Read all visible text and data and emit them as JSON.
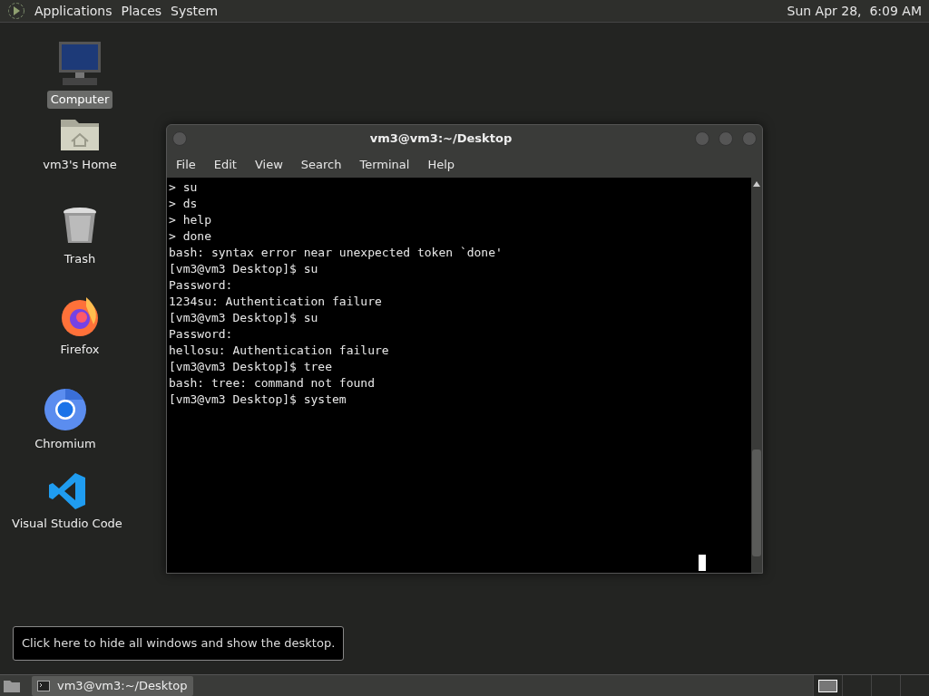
{
  "top_panel": {
    "menus": [
      "Applications",
      "Places",
      "System"
    ],
    "clock": "Sun Apr 28,  6:09 AM"
  },
  "desktop_icons": [
    {
      "kind": "computer",
      "label": "Computer",
      "selected": true
    },
    {
      "kind": "home",
      "label": "vm3's Home",
      "selected": false
    },
    {
      "kind": "trash",
      "label": "Trash",
      "selected": false
    },
    {
      "kind": "firefox",
      "label": "Firefox",
      "selected": false
    },
    {
      "kind": "chromium",
      "label": "Chromium",
      "selected": false
    },
    {
      "kind": "vscode",
      "label": "Visual Studio Code",
      "selected": false
    }
  ],
  "terminal": {
    "title": "vm3@vm3:~/Desktop",
    "menus": [
      "File",
      "Edit",
      "View",
      "Search",
      "Terminal",
      "Help"
    ],
    "lines": [
      "> su",
      "> ds",
      "> help",
      "> done",
      "bash: syntax error near unexpected token `done'",
      "[vm3@vm3 Desktop]$ su",
      "Password:",
      "1234su: Authentication failure",
      "[vm3@vm3 Desktop]$ su",
      "Password:",
      "hellosu: Authentication failure",
      "[vm3@vm3 Desktop]$ tree",
      "bash: tree: command not found",
      "[vm3@vm3 Desktop]$ system"
    ]
  },
  "tooltip": "Click here to hide all windows and show the desktop.",
  "bottom_panel": {
    "tasks": [
      {
        "label": "vm3@vm3:~/Desktop",
        "selected": true
      }
    ],
    "workspaces": [
      {
        "selected": true
      },
      {
        "selected": false
      },
      {
        "selected": false
      },
      {
        "selected": false
      }
    ]
  }
}
